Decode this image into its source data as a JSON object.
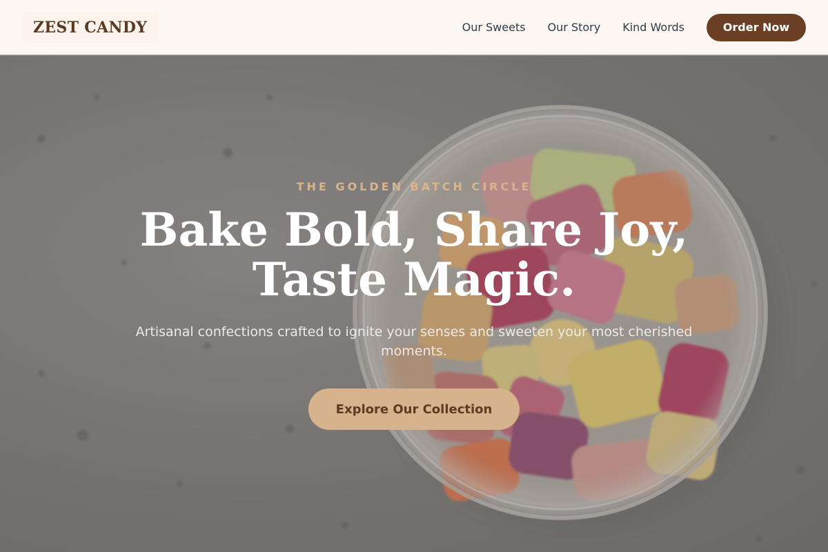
{
  "header": {
    "logo": "ZEST CANDY",
    "nav": [
      {
        "label": "Our Sweets"
      },
      {
        "label": "Our Story"
      },
      {
        "label": "Kind Words"
      }
    ],
    "order_label": "Order Now"
  },
  "hero": {
    "image": "jar-of-candies-photo",
    "eyebrow": "THE GOLDEN BATCH CIRCLE",
    "headline": "Bake Bold, Share Joy, Taste Magic.",
    "subhead": "Artisanal confections crafted to ignite your senses and sweeten your most cherished moments.",
    "cta_label": "Explore Our Collection"
  },
  "colors": {
    "brand_brown": "#6b3f24",
    "accent_gold": "#d6b38c",
    "nav_bg": "#fdf8f4"
  }
}
